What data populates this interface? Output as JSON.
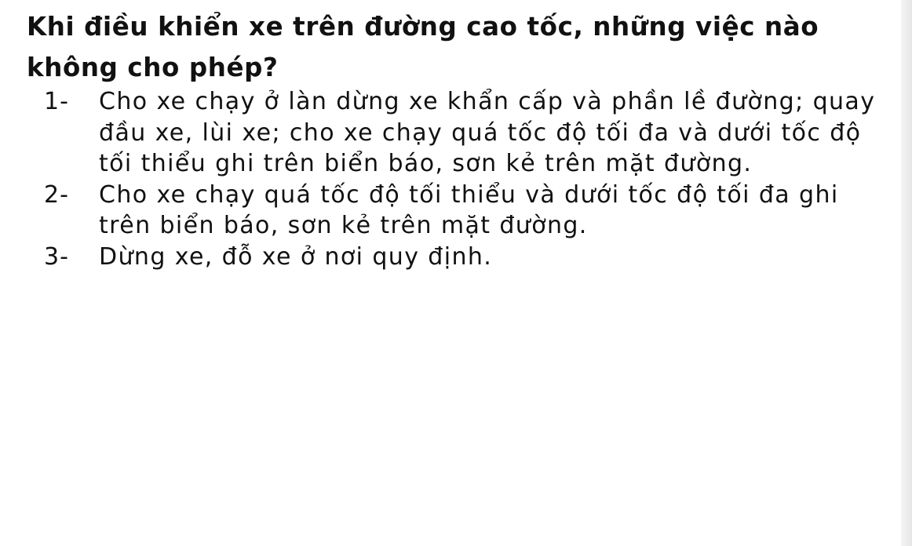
{
  "question": "Khi điều khiển xe trên đường cao tốc, những việc nào không cho phép?",
  "options": [
    {
      "number": "1-",
      "text": "Cho xe chạy ở làn dừng xe khẩn cấp và phần lề đường; quay đầu xe, lùi xe; cho xe chạy quá tốc độ tối đa và dưới tốc độ tối thiểu ghi trên biển báo, sơn kẻ trên mặt đường."
    },
    {
      "number": "2-",
      "text": "Cho xe chạy quá tốc độ tối thiểu và dưới tốc độ tối đa ghi trên biển báo, sơn kẻ trên mặt đường."
    },
    {
      "number": "3-",
      "text": "Dừng xe, đỗ xe ở nơi quy định."
    }
  ]
}
